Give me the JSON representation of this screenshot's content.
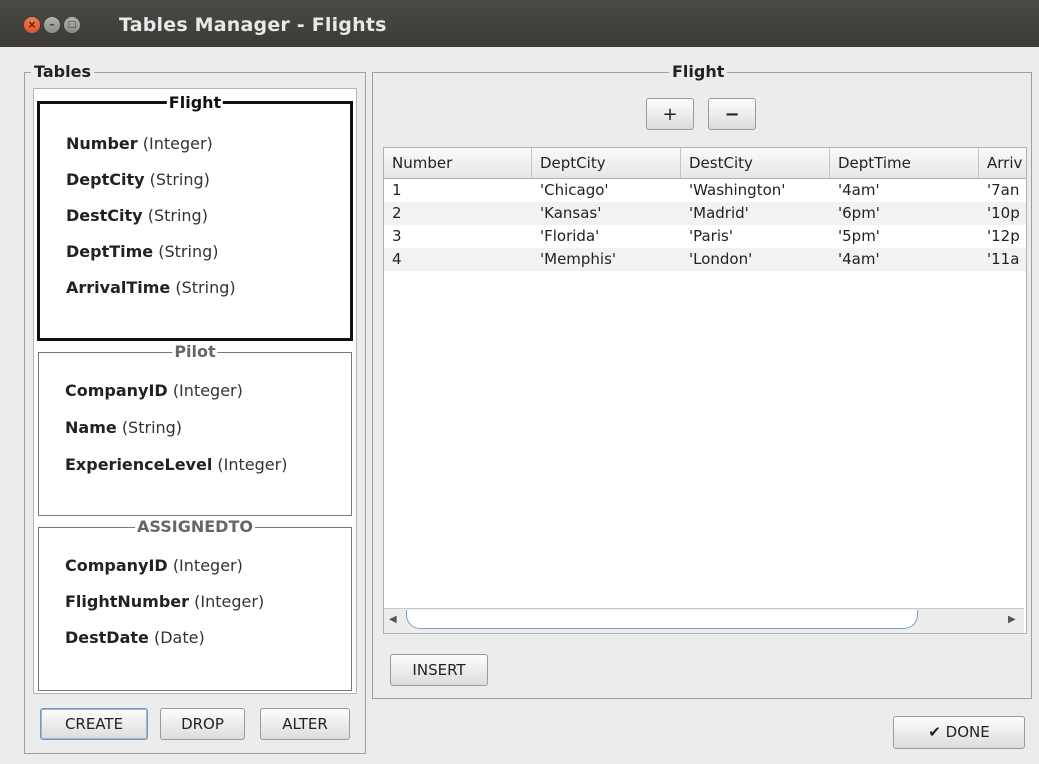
{
  "window": {
    "title": "Tables Manager - Flights",
    "controls": {
      "close": "×",
      "minimize": "–",
      "maximize": "□"
    }
  },
  "tables_panel": {
    "legend": "Tables",
    "tables": [
      {
        "name": "Flight",
        "selected": true,
        "attributes": [
          {
            "name": "Number",
            "type": "(Integer)"
          },
          {
            "name": "DeptCity",
            "type": "(String)"
          },
          {
            "name": "DestCity",
            "type": "(String)"
          },
          {
            "name": "DeptTime",
            "type": "(String)"
          },
          {
            "name": "ArrivalTime",
            "type": "(String)"
          }
        ]
      },
      {
        "name": "Pilot",
        "selected": false,
        "attributes": [
          {
            "name": "CompanyID",
            "type": "(Integer)"
          },
          {
            "name": "Name",
            "type": "(String)"
          },
          {
            "name": "ExperienceLevel",
            "type": "(Integer)"
          }
        ]
      },
      {
        "name": "ASSIGNEDTO",
        "selected": false,
        "attributes": [
          {
            "name": "CompanyID",
            "type": "(Integer)"
          },
          {
            "name": "FlightNumber",
            "type": "(Integer)"
          },
          {
            "name": "DestDate",
            "type": "(Date)"
          }
        ]
      }
    ],
    "buttons": {
      "create": "CREATE",
      "drop": "DROP",
      "alter": "ALTER"
    }
  },
  "data_panel": {
    "legend": "Flight",
    "add_label": "+",
    "remove_label": "−",
    "columns": [
      "Number",
      "DeptCity",
      "DestCity",
      "DeptTime",
      "Arriv"
    ],
    "rows": [
      [
        "1",
        "'Chicago'",
        "'Washington'",
        "'4am'",
        "'7an"
      ],
      [
        "2",
        "'Kansas'",
        "'Madrid'",
        "'6pm'",
        "'10p"
      ],
      [
        "3",
        "'Florida'",
        "'Paris'",
        "'5pm'",
        "'12p"
      ],
      [
        "4",
        "'Memphis'",
        "'London'",
        "'4am'",
        "'11a"
      ]
    ],
    "scroll_left": "◀",
    "scroll_right": "▶",
    "insert_label": "INSERT"
  },
  "done_button": {
    "check": "✔",
    "label": "DONE"
  }
}
